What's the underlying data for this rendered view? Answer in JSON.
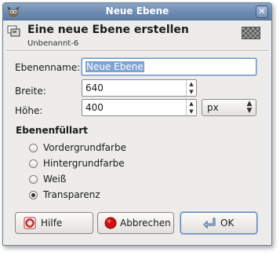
{
  "window": {
    "title": "Neue Ebene",
    "close_glyph": "✕",
    "app_icon": "wilber-icon"
  },
  "header": {
    "title": "Eine neue Ebene erstellen",
    "subtitle": "Unbenannt-6",
    "icon": "layer-icon",
    "preview": "transparency-preview"
  },
  "form": {
    "name_label": "Ebenenname:",
    "name_value": "Neue Ebene",
    "width_label": "Breite:",
    "width_value": "640",
    "height_label": "Höhe:",
    "height_value": "400",
    "unit": "px"
  },
  "fill": {
    "heading": "Ebenenfüllart",
    "options": [
      "Vordergrundfarbe",
      "Hintergrundfarbe",
      "Weiß",
      "Transparenz"
    ],
    "selected": "Transparenz"
  },
  "buttons": {
    "help": "Hilfe",
    "cancel": "Abbrechen",
    "ok": "OK"
  },
  "colors": {
    "titlebar": "#6d8bb2",
    "dialog_bg": "#edeceb",
    "selection": "#7fa3d2",
    "cancel_red": "#d01010"
  }
}
